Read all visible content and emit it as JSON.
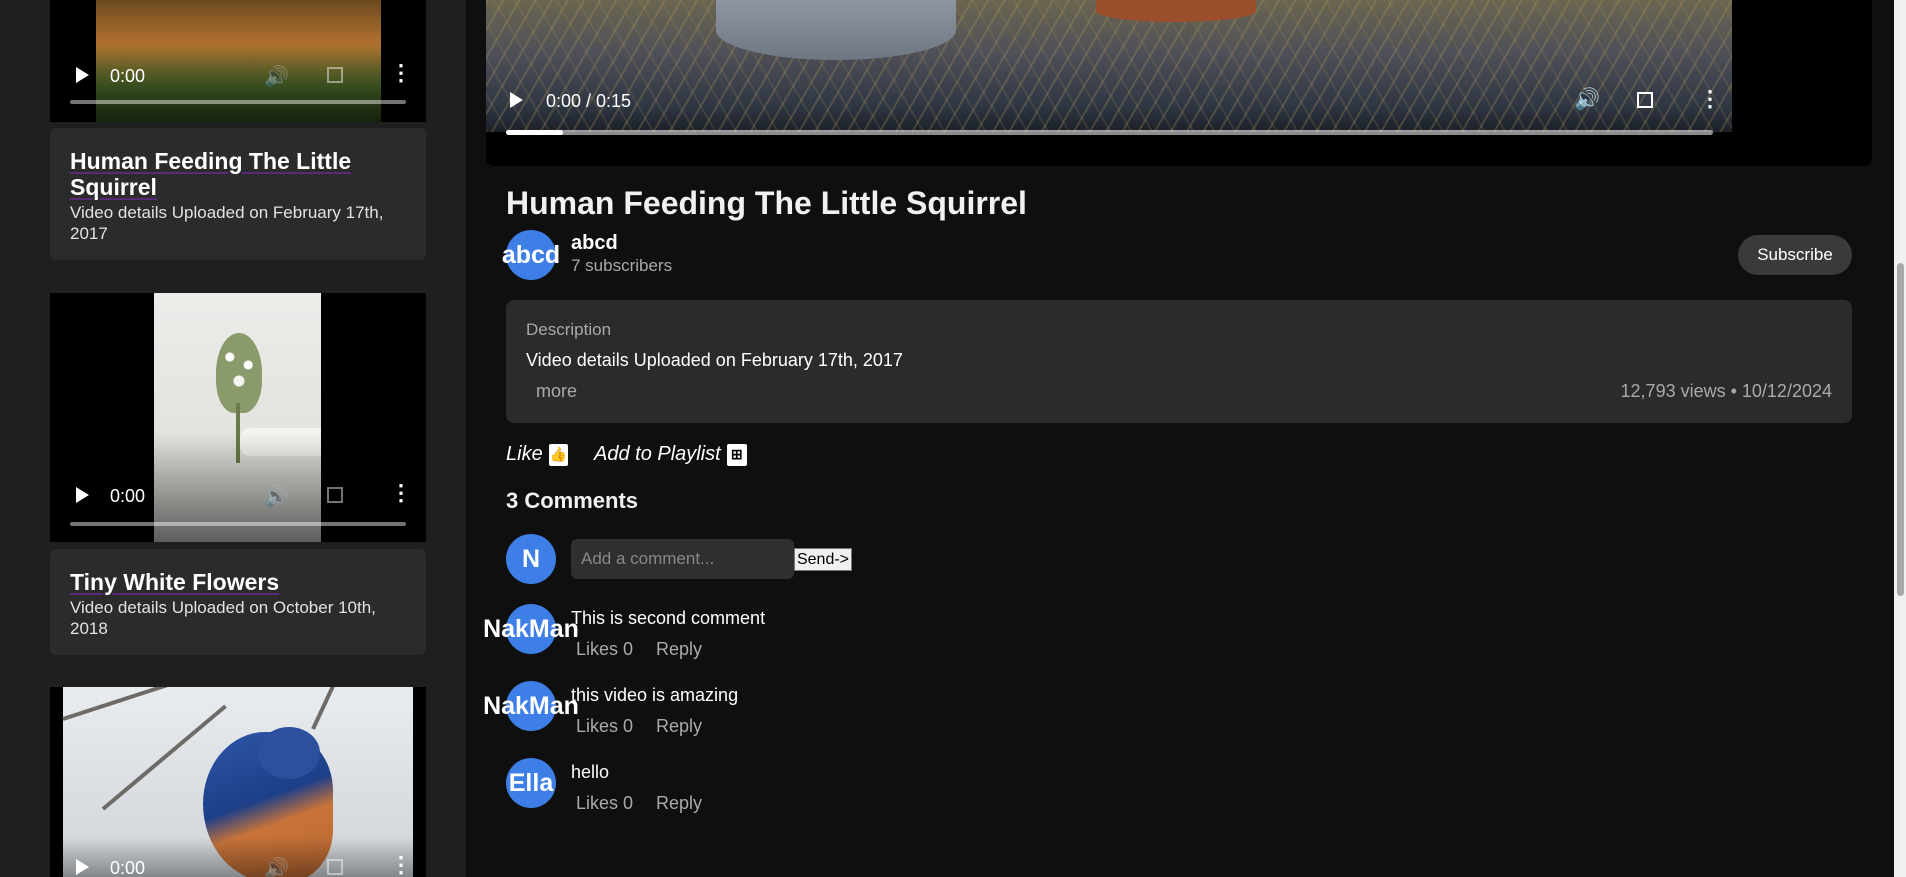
{
  "sidebar": {
    "videos": [
      {
        "time": "0:00"
      },
      {
        "time": "0:00"
      },
      {
        "time": "0:00"
      }
    ],
    "cards": [
      {
        "title": "Human Feeding The Little Squirrel",
        "meta": "Video details Uploaded on February 17th, 2017"
      },
      {
        "title": "Tiny White Flowers",
        "meta": "Video details Uploaded on October 10th, 2018"
      }
    ]
  },
  "player": {
    "time": "0:00 / 0:15",
    "progress": 0.047
  },
  "video": {
    "title": "Human Feeding The Little Squirrel",
    "channel": {
      "avatar": "abcd",
      "name": "abcd",
      "subscribers": "7 subscribers"
    },
    "subscribe_label": "Subscribe",
    "description": {
      "heading": "Description",
      "text": "Video details Uploaded on February 17th, 2017",
      "more": "more",
      "stats": "12,793 views • 10/12/2024"
    }
  },
  "actions": {
    "like": "Like",
    "like_icon": "thumbs-up-icon",
    "playlist": "Add to Playlist",
    "playlist_icon": "plus-square-icon"
  },
  "comments": {
    "count_label": "3 Comments",
    "user_avatar": "N",
    "placeholder": "Add a comment...",
    "send_label": "Send->",
    "likes_label": "Likes 0",
    "reply_label": "Reply",
    "items": [
      {
        "author": "NakMan",
        "text": "This is second comment"
      },
      {
        "author": "NakMan",
        "text": "this video is amazing"
      },
      {
        "author": "Ella",
        "text": "hello"
      }
    ]
  },
  "colors": {
    "accent": "#3d7fe6",
    "background": "#0f0f0f",
    "sidebar": "#1f1f1f",
    "card": "#2b2b2b"
  }
}
